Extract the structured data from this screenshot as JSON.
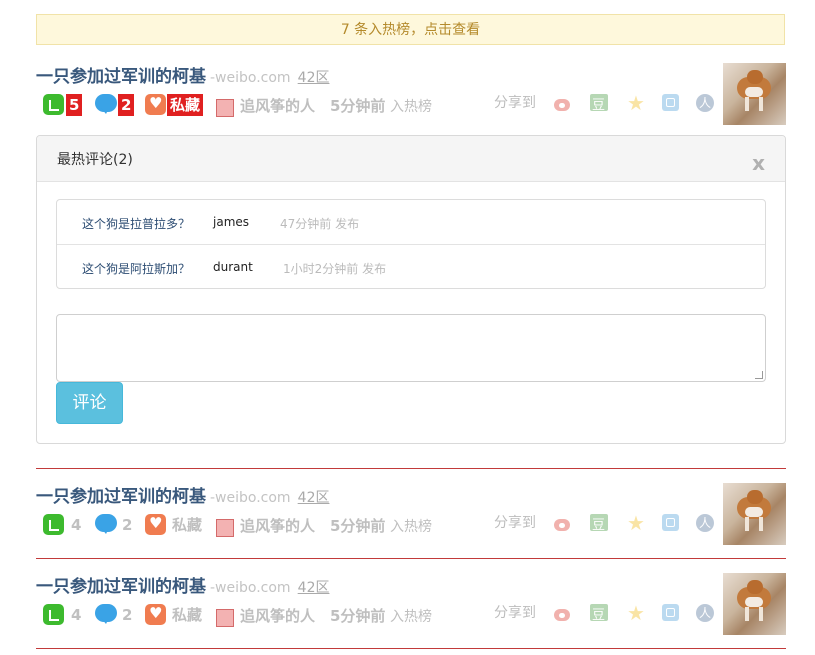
{
  "banner": {
    "text": "7 条入热榜，点击查看"
  },
  "items": [
    {
      "title": "一只参加过军训的柯基",
      "source": "-weibo.com",
      "zone": "42区",
      "likes": "5",
      "comments": "2",
      "favorite_label": "私藏",
      "author": "追风筝的人",
      "time": "5分钟前",
      "hot_label": "入热榜",
      "share_label": "分享到",
      "highlighted": true
    },
    {
      "title": "一只参加过军训的柯基",
      "source": "-weibo.com",
      "zone": "42区",
      "likes": "4",
      "comments": "2",
      "favorite_label": "私藏",
      "author": "追风筝的人",
      "time": "5分钟前",
      "hot_label": "入热榜",
      "share_label": "分享到",
      "highlighted": false
    },
    {
      "title": "一只参加过军训的柯基",
      "source": "-weibo.com",
      "zone": "42区",
      "likes": "4",
      "comments": "2",
      "favorite_label": "私藏",
      "author": "追风筝的人",
      "time": "5分钟前",
      "hot_label": "入热榜",
      "share_label": "分享到",
      "highlighted": false
    }
  ],
  "comment_panel": {
    "title": "最热评论(2)",
    "close_label": "x",
    "comments": [
      {
        "text": "这个狗是拉普拉多？",
        "user": "james",
        "time": "47分钟前 发布"
      },
      {
        "text": "这个狗是阿拉斯加？",
        "user": "durant",
        "time": "1小时2分钟前 发布"
      }
    ],
    "input_value": "",
    "submit_label": "评论"
  },
  "share_icons": [
    "weibo-icon",
    "douban-icon",
    "star-icon",
    "qzone-icon",
    "renren-icon"
  ],
  "colors": {
    "accent_red": "#e02020",
    "link_blue": "#39587c",
    "button_blue": "#5bc0de"
  }
}
